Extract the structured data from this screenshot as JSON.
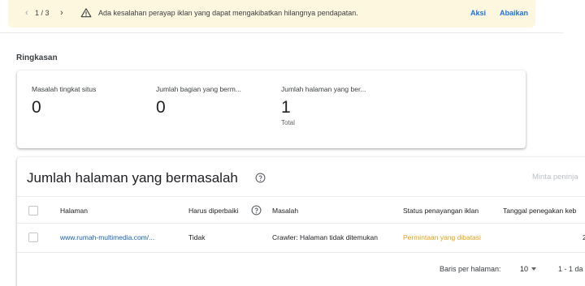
{
  "banner": {
    "pager": "1 / 3",
    "message": "Ada kesalahan perayap iklan yang dapat mengakibatkan hilangnya pendapatan.",
    "action_label": "Aksi",
    "dismiss_label": "Abaikan",
    "warning_icon": "warning-triangle-icon"
  },
  "summary": {
    "title": "Ringkasan",
    "metrics": [
      {
        "label": "Masalah tingkat situs",
        "value": "0",
        "sub": ""
      },
      {
        "label": "Jumlah bagian yang berm...",
        "value": "0",
        "sub": ""
      },
      {
        "label": "Jumlah halaman yang ber...",
        "value": "1",
        "sub": "Total"
      }
    ]
  },
  "table": {
    "title": "Jumlah halaman yang bermasalah",
    "request_label": "Minta peninja",
    "columns": [
      "Halaman",
      "Harus diperbaiki",
      "Masalah",
      "Status penayangan iklan",
      "Tanggal penegakan keb"
    ],
    "rows": [
      {
        "page": "www.rumah-multimedia.com/...",
        "must_fix": "Tidak",
        "issue": "Crawler: Halaman tidak ditemukan",
        "status": "Permintaan yang dibatasi",
        "date": "2"
      }
    ],
    "footer": {
      "rows_per_page_label": "Baris per halaman:",
      "rows_per_page_value": "10",
      "range": "1 - 1 da"
    }
  },
  "colors": {
    "banner_bg": "#fef7e0",
    "link": "#1a73e8",
    "url": "#1a5fb4",
    "status_warning": "#e8a21a"
  }
}
